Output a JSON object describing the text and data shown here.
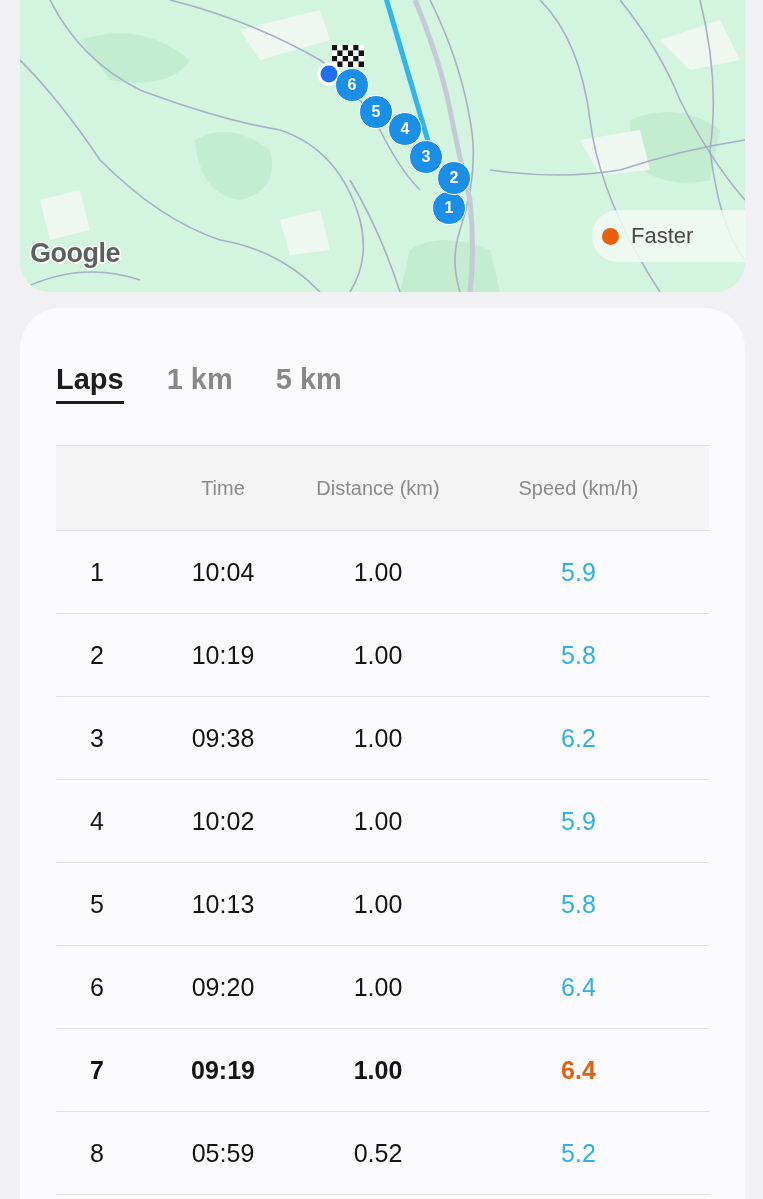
{
  "map": {
    "logo": "Google",
    "lap_markers": [
      {
        "label": "1"
      },
      {
        "label": "2"
      },
      {
        "label": "3"
      },
      {
        "label": "4"
      },
      {
        "label": "5"
      },
      {
        "label": "6"
      }
    ],
    "legend": {
      "label": "Faster"
    }
  },
  "tabs": [
    {
      "label": "Laps",
      "selected": true
    },
    {
      "label": "1 km",
      "selected": false
    },
    {
      "label": "5 km",
      "selected": false
    }
  ],
  "table": {
    "columns": [
      "Time",
      "Distance (km)",
      "Speed (km/h)"
    ],
    "rows": [
      {
        "lap": "1",
        "time": "10:04",
        "distance": "1.00",
        "speed": "5.9",
        "fastest": false
      },
      {
        "lap": "2",
        "time": "10:19",
        "distance": "1.00",
        "speed": "5.8",
        "fastest": false
      },
      {
        "lap": "3",
        "time": "09:38",
        "distance": "1.00",
        "speed": "6.2",
        "fastest": false
      },
      {
        "lap": "4",
        "time": "10:02",
        "distance": "1.00",
        "speed": "5.9",
        "fastest": false
      },
      {
        "lap": "5",
        "time": "10:13",
        "distance": "1.00",
        "speed": "5.8",
        "fastest": false
      },
      {
        "lap": "6",
        "time": "09:20",
        "distance": "1.00",
        "speed": "6.4",
        "fastest": false
      },
      {
        "lap": "7",
        "time": "09:19",
        "distance": "1.00",
        "speed": "6.4",
        "fastest": true
      },
      {
        "lap": "8",
        "time": "05:59",
        "distance": "0.52",
        "speed": "5.2",
        "fastest": false
      }
    ]
  }
}
